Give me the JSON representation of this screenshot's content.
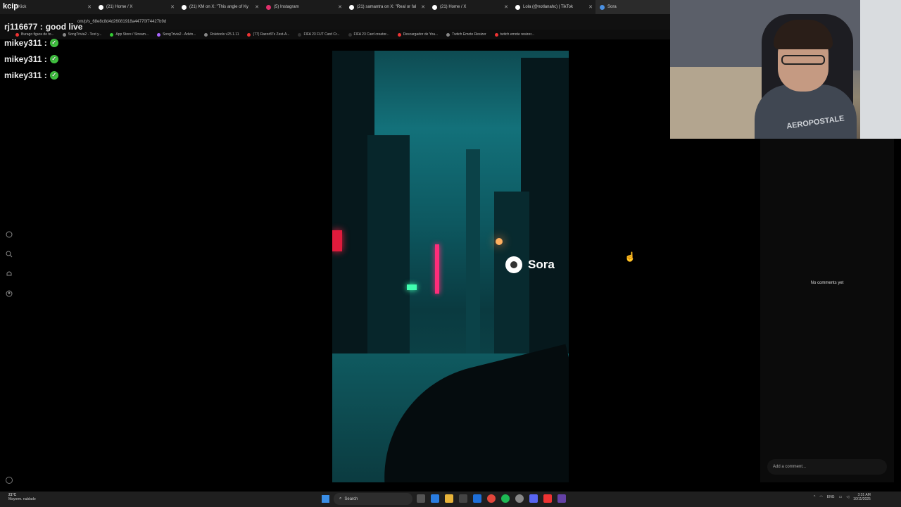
{
  "tabs": [
    {
      "label": "Kick",
      "color": "#53fc18"
    },
    {
      "label": "(21) Home / X",
      "color": "#ffffff"
    },
    {
      "label": "(21) KM on X: \"This angle of Ky",
      "color": "#ffffff"
    },
    {
      "label": "(5) Instagram",
      "color": "#e1306c"
    },
    {
      "label": "(21) samantra on X: \"Real or fal",
      "color": "#ffffff"
    },
    {
      "label": "(21) Home / X",
      "color": "#ffffff"
    },
    {
      "label": "Lola (@notlanahc) | TikTok",
      "color": "#ffffff"
    },
    {
      "label": "Sora",
      "color": "#4a90e2"
    }
  ],
  "url": "om/p/s_68e8c8d4d26081918a44770f74427b9d",
  "bookmarks": [
    "Burago figura de to...",
    "SongTrivia2 - Test y...",
    "App Store / Stream...",
    "SongTrivia2 - Advin...",
    "Roletools v25.1.11",
    "(77) Razor87s Zest-A...",
    "FIFA 23 FUT Card Cr...",
    "FIFA 23 Card creator...",
    "Descargador de You...",
    "Twitch Emote Resizer",
    "twitch emote resizer..."
  ],
  "overlay_logo": "kcip",
  "chat": [
    {
      "user": "rj116677 :",
      "message": "good live",
      "badge": false
    },
    {
      "user": "mikey311 :",
      "message": "",
      "badge": true
    },
    {
      "user": "mikey311 :",
      "message": "",
      "badge": true
    },
    {
      "user": "mikey311 :",
      "message": "",
      "badge": true
    }
  ],
  "rail_icons": [
    "home-icon",
    "search-icon",
    "bell-icon",
    "profile-icon"
  ],
  "video": {
    "watermark": "Sora"
  },
  "webcam": {
    "shirt_text": "AEROPOSTALE"
  },
  "comments": {
    "empty_text": "No comments yet",
    "add_placeholder": "Add a comment..."
  },
  "taskbar": {
    "weather_temp": "21°C",
    "weather_desc": "Mayorm. nublado",
    "search_label": "Search",
    "lang": "ENG",
    "time": "3:31 AM",
    "date": "10/11/2025"
  },
  "colors": {
    "accent_green": "#3fbf3f",
    "video_teal": "#13717a"
  }
}
